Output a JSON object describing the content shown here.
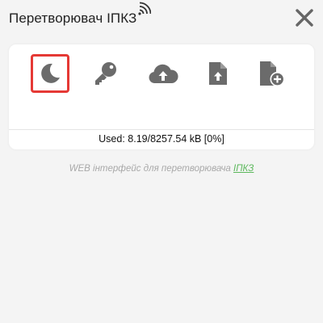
{
  "header": {
    "title": "Перетворювач ІПКЗ",
    "wifi_icon": "wifi-signal-icon",
    "close_icon": "close-icon"
  },
  "toolbar": {
    "items": [
      {
        "name": "theme-toggle",
        "icon": "moon-icon",
        "active": true
      },
      {
        "name": "password",
        "icon": "key-icon",
        "active": false
      },
      {
        "name": "firmware-upload",
        "icon": "cloud-upload-icon",
        "active": false
      },
      {
        "name": "file-upload",
        "icon": "file-upload-icon",
        "active": false
      },
      {
        "name": "new-file",
        "icon": "file-add-icon",
        "active": false
      }
    ]
  },
  "status": {
    "used_text": "Used: 8.19/8257.54 kB [0%]"
  },
  "footer": {
    "text": "WEB інтерфейс для перетворювача ",
    "link_text": "ІПКЗ"
  },
  "colors": {
    "background": "#f4f4f4",
    "card": "#ffffff",
    "icon_gray": "#6b6b6b",
    "active_border": "#e53935",
    "link_green": "#5cb85c",
    "footer_text": "#a9a9a9"
  }
}
